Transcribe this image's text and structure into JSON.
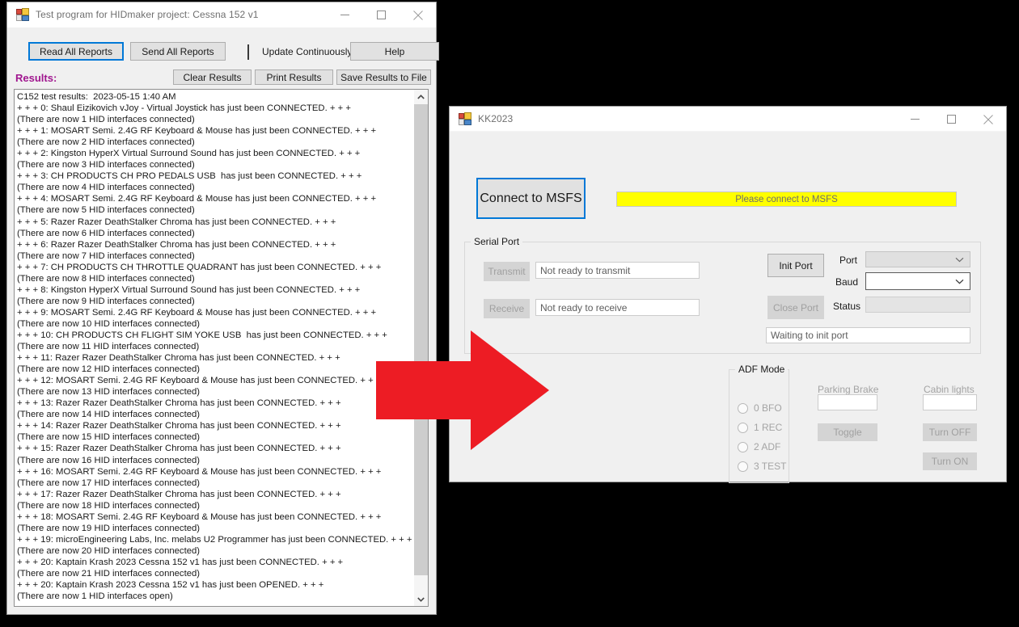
{
  "hidmaker_window": {
    "title": "Test program for HIDmaker project: Cessna 152 v1",
    "icon": "vb-form-icon",
    "window_controls": {
      "minimize": "minimize-icon",
      "maximize": "maximize-icon",
      "close": "close-icon"
    },
    "toolbar": {
      "read_all_reports": "Read All Reports",
      "send_all_reports": "Send All Reports",
      "update_continuously": "Update Continuously",
      "update_continuously_checked": false,
      "help": "Help",
      "clear_results": "Clear Results",
      "print_results": "Print Results",
      "save_results_to_file": "Save Results to File"
    },
    "results_label": "Results:",
    "results_label_color": "#a0168f",
    "results_text": "C152 test results:  2023-05-15 1:40 AM\n+ + + 0: Shaul Eizikovich vJoy - Virtual Joystick has just been CONNECTED. + + +\n(There are now 1 HID interfaces connected)\n+ + + 1: MOSART Semi. 2.4G RF Keyboard & Mouse has just been CONNECTED. + + +\n(There are now 2 HID interfaces connected)\n+ + + 2: Kingston HyperX Virtual Surround Sound has just been CONNECTED. + + +\n(There are now 3 HID interfaces connected)\n+ + + 3: CH PRODUCTS CH PRO PEDALS USB  has just been CONNECTED. + + +\n(There are now 4 HID interfaces connected)\n+ + + 4: MOSART Semi. 2.4G RF Keyboard & Mouse has just been CONNECTED. + + +\n(There are now 5 HID interfaces connected)\n+ + + 5: Razer Razer DeathStalker Chroma has just been CONNECTED. + + +\n(There are now 6 HID interfaces connected)\n+ + + 6: Razer Razer DeathStalker Chroma has just been CONNECTED. + + +\n(There are now 7 HID interfaces connected)\n+ + + 7: CH PRODUCTS CH THROTTLE QUADRANT has just been CONNECTED. + + +\n(There are now 8 HID interfaces connected)\n+ + + 8: Kingston HyperX Virtual Surround Sound has just been CONNECTED. + + +\n(There are now 9 HID interfaces connected)\n+ + + 9: MOSART Semi. 2.4G RF Keyboard & Mouse has just been CONNECTED. + + +\n(There are now 10 HID interfaces connected)\n+ + + 10: CH PRODUCTS CH FLIGHT SIM YOKE USB  has just been CONNECTED. + + +\n(There are now 11 HID interfaces connected)\n+ + + 11: Razer Razer DeathStalker Chroma has just been CONNECTED. + + +\n(There are now 12 HID interfaces connected)\n+ + + 12: MOSART Semi. 2.4G RF Keyboard & Mouse has just been CONNECTED. + + +\n(There are now 13 HID interfaces connected)\n+ + + 13: Razer Razer DeathStalker Chroma has just been CONNECTED. + + +\n(There are now 14 HID interfaces connected)\n+ + + 14: Razer Razer DeathStalker Chroma has just been CONNECTED. + + +\n(There are now 15 HID interfaces connected)\n+ + + 15: Razer Razer DeathStalker Chroma has just been CONNECTED. + + +\n(There are now 16 HID interfaces connected)\n+ + + 16: MOSART Semi. 2.4G RF Keyboard & Mouse has just been CONNECTED. + + +\n(There are now 17 HID interfaces connected)\n+ + + 17: Razer Razer DeathStalker Chroma has just been CONNECTED. + + +\n(There are now 18 HID interfaces connected)\n+ + + 18: MOSART Semi. 2.4G RF Keyboard & Mouse has just been CONNECTED. + + +\n(There are now 19 HID interfaces connected)\n+ + + 19: microEngineering Labs, Inc. melabs U2 Programmer has just been CONNECTED. + + +\n(There are now 20 HID interfaces connected)\n+ + + 20: Kaptain Krash 2023 Cessna 152 v1 has just been CONNECTED. + + +\n(There are now 21 HID interfaces connected)\n+ + + 20: Kaptain Krash 2023 Cessna 152 v1 has just been OPENED. + + +\n(There are now 1 HID interfaces open)",
    "scrollbar": {
      "up_arrow": "chevron-up-icon",
      "down_arrow": "chevron-down-icon"
    }
  },
  "kk_window": {
    "title": "KK2023",
    "icon": "vb-form-icon",
    "window_controls": {
      "minimize": "minimize-icon",
      "maximize": "maximize-icon",
      "close": "close-icon"
    },
    "connect_button": "Connect to MSFS",
    "status_banner": {
      "text": "Please connect to MSFS",
      "background": "#ffff00",
      "text_color": "#6d6d6d"
    },
    "serial_port": {
      "group_label": "Serial Port",
      "transmit_button": "Transmit",
      "transmit_value": "Not ready to transmit",
      "receive_button": "Receive",
      "receive_value": "Not ready to receive",
      "init_port_button": "Init Port",
      "close_port_button": "Close Port",
      "port_label": "Port",
      "port_value": "",
      "baud_label": "Baud",
      "baud_value": "",
      "status_label": "Status",
      "status_value": "",
      "port_state": "Waiting to init port"
    },
    "adf_mode": {
      "group_label": "ADF Mode",
      "options": [
        {
          "label": "0 BFO",
          "selected": false
        },
        {
          "label": "1 REC",
          "selected": false
        },
        {
          "label": "2 ADF",
          "selected": false
        },
        {
          "label": "3 TEST",
          "selected": false
        }
      ]
    },
    "parking_brake": {
      "label": "Parking Brake",
      "value": "",
      "toggle_button": "Toggle"
    },
    "cabin_lights": {
      "label": "Cabin lights",
      "value": "",
      "turn_off_button": "Turn OFF",
      "turn_on_button": "Turn ON"
    }
  },
  "annotation": {
    "arrow": "red-right-arrow",
    "color": "#ed1c24"
  }
}
